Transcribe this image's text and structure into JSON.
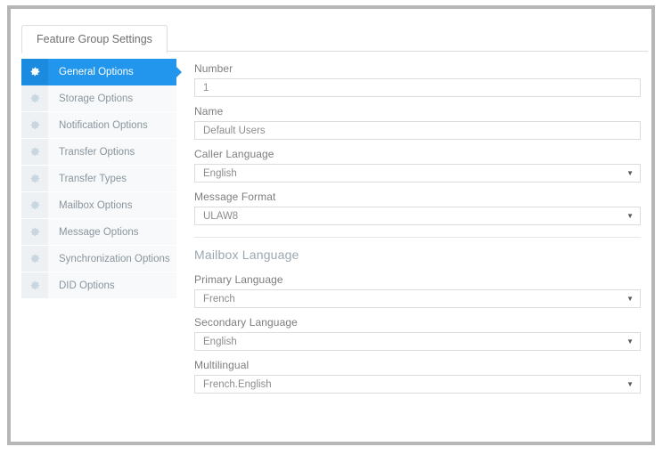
{
  "window": {
    "tab_label": "Feature Group Settings"
  },
  "sidebar": {
    "items": [
      {
        "label": "General Options",
        "icon": "gear-icon",
        "active": true
      },
      {
        "label": "Storage Options",
        "icon": "gear-icon",
        "active": false
      },
      {
        "label": "Notification Options",
        "icon": "gear-icon",
        "active": false
      },
      {
        "label": "Transfer Options",
        "icon": "gear-icon",
        "active": false
      },
      {
        "label": "Transfer Types",
        "icon": "gear-icon",
        "active": false
      },
      {
        "label": "Mailbox Options",
        "icon": "gear-icon",
        "active": false
      },
      {
        "label": "Message Options",
        "icon": "gear-icon",
        "active": false
      },
      {
        "label": "Synchronization Options",
        "icon": "gear-icon",
        "active": false
      },
      {
        "label": "DID Options",
        "icon": "gear-icon",
        "active": false
      }
    ]
  },
  "form": {
    "fields": [
      {
        "label": "Number",
        "value": "1",
        "type": "text"
      },
      {
        "label": "Name",
        "value": "Default Users",
        "type": "text"
      },
      {
        "label": "Caller Language",
        "value": "English",
        "type": "select"
      },
      {
        "label": "Message Format",
        "value": "ULAW8",
        "type": "select"
      }
    ],
    "section": {
      "title": "Mailbox Language",
      "fields": [
        {
          "label": "Primary Language",
          "value": "French",
          "type": "select"
        },
        {
          "label": "Secondary Language",
          "value": "English",
          "type": "select"
        },
        {
          "label": "Multilingual",
          "value": "French.English",
          "type": "select"
        }
      ]
    }
  },
  "icons": {
    "caret_down": "▼"
  },
  "colors": {
    "accent": "#2196ec",
    "accent_dark": "#1b8bdf",
    "frame": "#b6b6b6",
    "nav_bg": "#f7f9fa",
    "nav_icon_bg": "#edf1f4",
    "label_text": "#7e7e7e",
    "value_text": "#8d8d8d",
    "section_title": "#9aa7b1"
  }
}
